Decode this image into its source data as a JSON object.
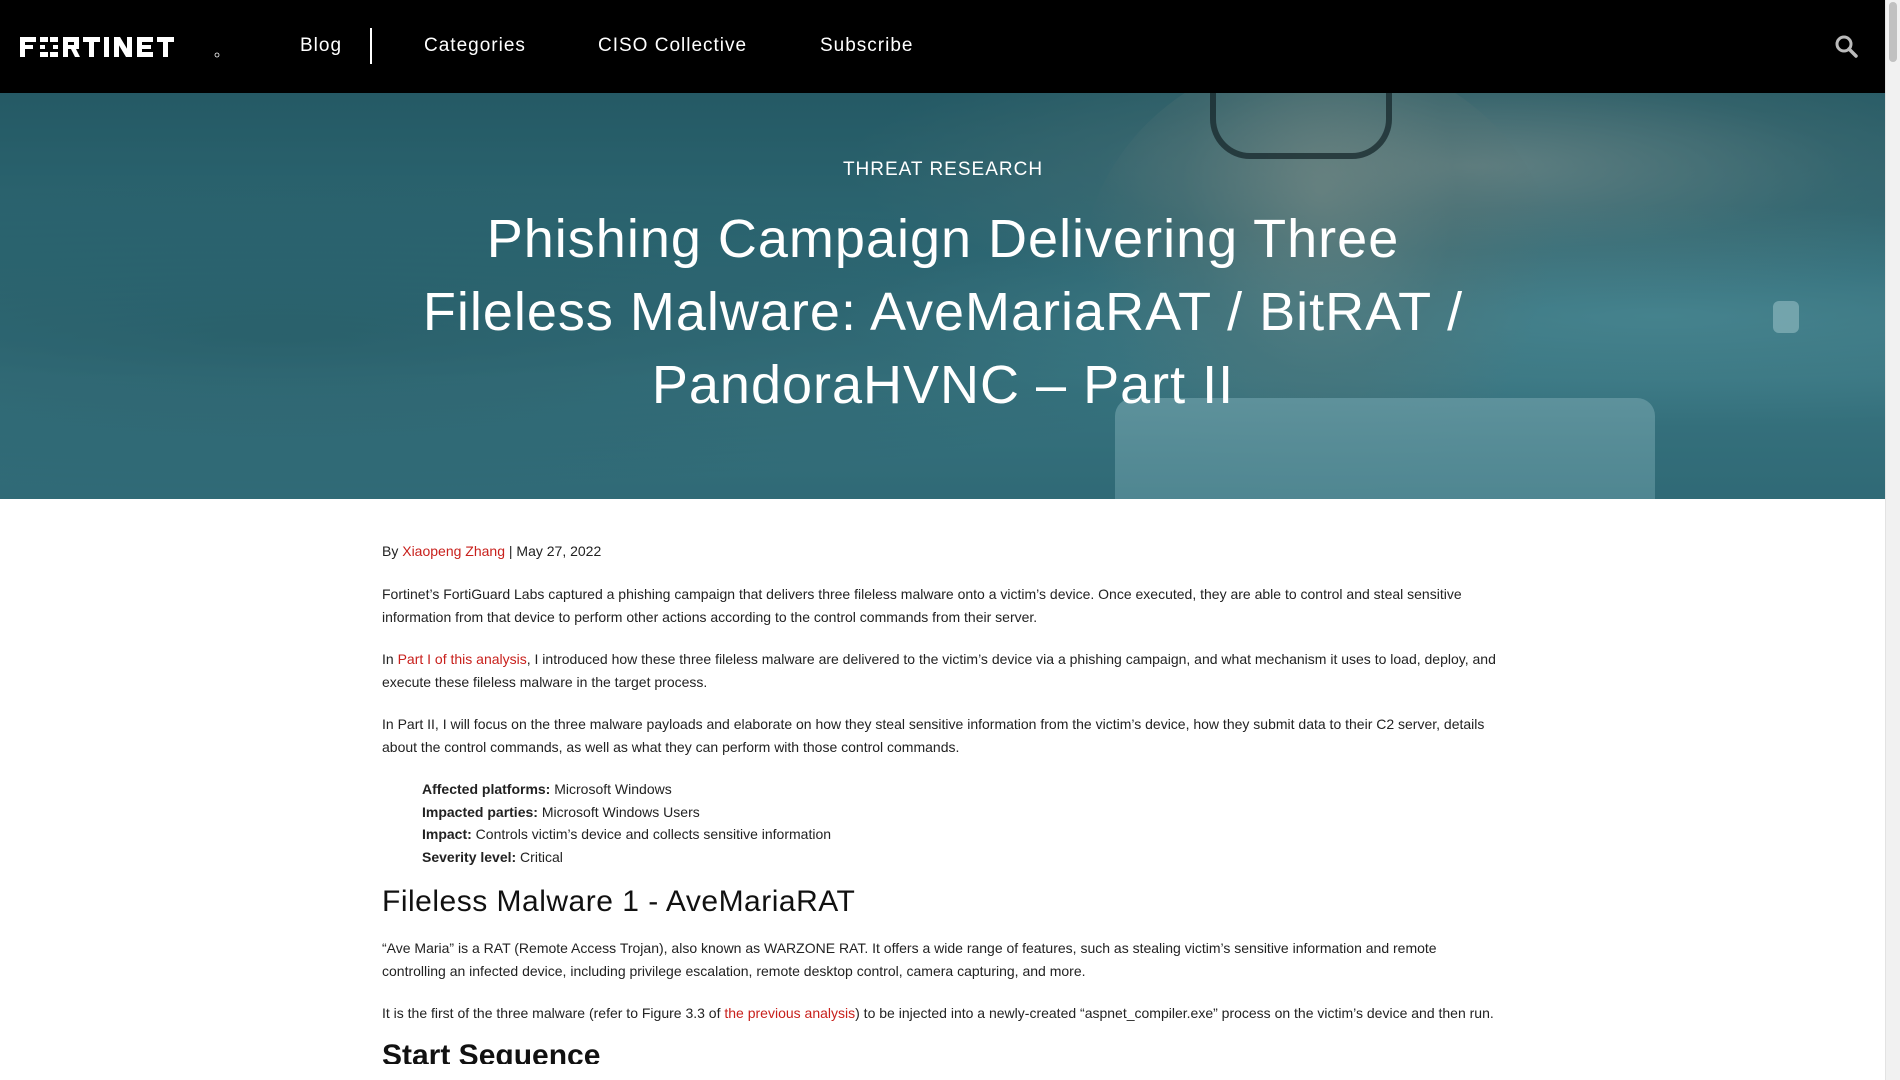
{
  "nav": {
    "logo_text": "FORTINET",
    "items": [
      {
        "label": "Blog"
      },
      {
        "label": "Categories"
      },
      {
        "label": "CISO Collective"
      },
      {
        "label": "Subscribe"
      }
    ],
    "search_icon": "search-icon"
  },
  "hero": {
    "category": "THREAT RESEARCH",
    "title": "Phishing Campaign Delivering Three Fileless Malware: AveMariaRAT / BitRAT / PandoraHVNC – Part II"
  },
  "article": {
    "byline": {
      "prefix": "By ",
      "author": "Xiaopeng Zhang",
      "separator": " | ",
      "date": "May 27, 2022"
    },
    "p1": "Fortinet’s FortiGuard Labs captured a phishing campaign that delivers three fileless malware onto a victim’s device. Once executed, they are able to control and steal sensitive information from that device to perform other actions according to the control commands from their server.",
    "p2": {
      "prefix": "In ",
      "link": "Part I of this analysis",
      "suffix": ", I introduced how these three fileless malware are delivered to the victim’s device via a phishing campaign, and what mechanism it uses to load, deploy, and execute these fileless malware in the target process."
    },
    "p3": "In Part II, I will focus on the three malware payloads and elaborate on how they steal sensitive information from the victim’s device, how they submit data to their C2 server, details about the control commands, as well as what they can perform with those control commands.",
    "meta": [
      {
        "label": "Affected platforms:",
        "value": " Microsoft Windows"
      },
      {
        "label": "Impacted parties:",
        "value": " Microsoft Windows Users"
      },
      {
        "label": "Impact:",
        "value": " Controls victim’s device and collects sensitive information"
      },
      {
        "label": "Severity level:",
        "value": " Critical"
      }
    ],
    "section_heading": "Fileless Malware 1 - AveMariaRAT",
    "p4": "“Ave Maria” is a RAT (Remote Access Trojan), also known as WARZONE RAT. It offers a wide range of features, such as stealing victim’s sensitive information and remote controlling an infected device, including privilege escalation, remote desktop control, camera capturing, and more.",
    "p5": {
      "prefix": "It is the first of the three malware (refer to Figure 3.3 of ",
      "link": "the previous analysis",
      "suffix": ") to be injected into a newly-created “aspnet_compiler.exe” process on the victim’s device and then run."
    },
    "next_heading": "Start Sequence"
  },
  "colors": {
    "nav_bg": "#000000",
    "link": "#c8201c",
    "hero_tint": "#3b7a86"
  }
}
